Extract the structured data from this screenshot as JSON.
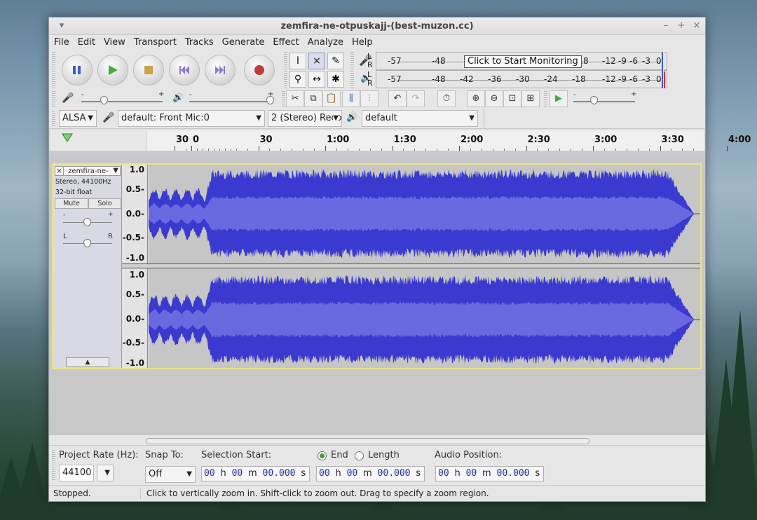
{
  "window": {
    "title": "zemfira-ne-otpuskajj-(best-muzon.cc)"
  },
  "menu": [
    "File",
    "Edit",
    "View",
    "Transport",
    "Tracks",
    "Generate",
    "Effect",
    "Analyze",
    "Help"
  ],
  "transport": {
    "buttons": [
      "pause-icon",
      "play-icon",
      "stop-icon",
      "skip-to-start-icon",
      "skip-to-end-icon",
      "record-icon"
    ],
    "colors": {
      "pause": "#3a5fd0",
      "play": "#3fae3a",
      "stop": "#c9a24a",
      "skip": "#8a7ad6",
      "record": "#c23a3a"
    }
  },
  "meters": {
    "record": {
      "channels": [
        "L",
        "R"
      ],
      "ticks": [
        "-57",
        "-48",
        "-42",
        "-36",
        "-30",
        "-24",
        "-18",
        "-12",
        "-9",
        "-6",
        "-3",
        "0"
      ]
    },
    "playback": {
      "channels": [
        "L",
        "R"
      ],
      "ticks": [
        "-57",
        "-48",
        "-42",
        "-36",
        "-30",
        "-24",
        "-18",
        "-12",
        "-9",
        "-6",
        "-3",
        "0"
      ]
    },
    "tooltip": "Click to Start Monitoring",
    "record_tick_under_tooltip": "-18",
    "peak_color": "#d03030"
  },
  "mixer": {
    "minus": "-",
    "plus": "+"
  },
  "device": {
    "host": "ALSA",
    "input": "default: Front Mic:0",
    "channels": "2 (Stereo) Reco",
    "output": "default"
  },
  "ruler": {
    "labels": [
      "30",
      "0",
      "30",
      "1:00",
      "1:30",
      "2:00",
      "2:30",
      "3:00",
      "3:30",
      "4:00"
    ]
  },
  "track": {
    "name": "zemfira-ne-",
    "info1": "Stereo, 44100Hz",
    "info2": "32-bit float",
    "mute": "Mute",
    "solo": "Solo",
    "gain_minus": "-",
    "gain_plus": "+",
    "pan_left": "L",
    "pan_right": "R",
    "scale": [
      "1.0",
      "0.5-",
      "0.0-",
      "-0.5-",
      "-1.0"
    ],
    "wave_color": "#3a3ad0",
    "rms_color": "#6a6ae0"
  },
  "selection": {
    "project_rate_label": "Project Rate (Hz):",
    "project_rate": "44100",
    "snap_label": "Snap To:",
    "snap_value": "Off",
    "start_label": "Selection Start:",
    "end_label": "End",
    "length_label": "Length",
    "audio_position_label": "Audio Position:",
    "time_start": {
      "h": "00",
      "m": "00",
      "s": "00.000"
    },
    "time_end": {
      "h": "00",
      "m": "00",
      "s": "00.000"
    },
    "time_audio": {
      "h": "00",
      "m": "00",
      "s": "00.000"
    },
    "unit_h": "h",
    "unit_m": "m",
    "unit_s": "s"
  },
  "status": {
    "left": "Stopped.",
    "right": "Click to vertically zoom in. Shift-click to zoom out. Drag to specify a zoom region."
  }
}
